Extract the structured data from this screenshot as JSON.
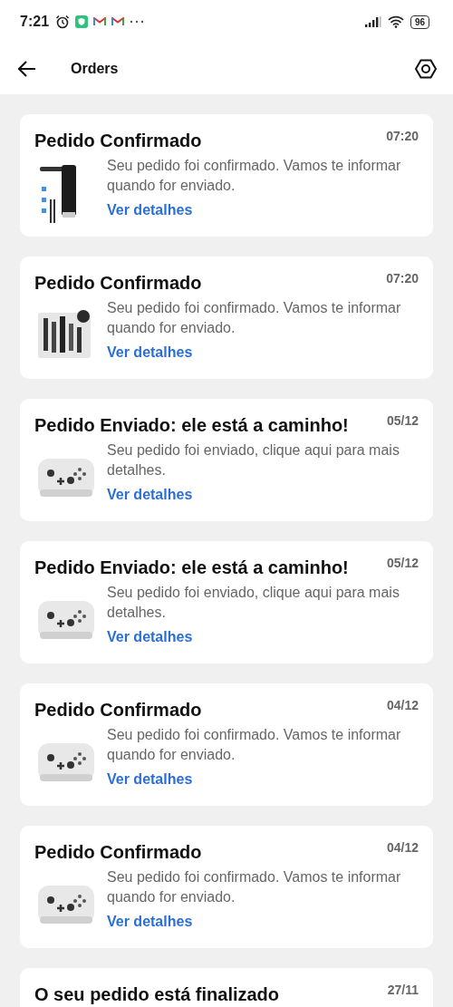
{
  "status_bar": {
    "time": "7:21",
    "battery": "96"
  },
  "header": {
    "title": "Orders"
  },
  "orders": [
    {
      "title": "Pedido Confirmado",
      "time": "07:20",
      "message": "Seu pedido foi confirmado. Vamos te informar quando for enviado.",
      "link": "Ver detalhes"
    },
    {
      "title": "Pedido Confirmado",
      "time": "07:20",
      "message": "Seu pedido foi confirmado. Vamos te informar quando for enviado.",
      "link": "Ver detalhes"
    },
    {
      "title": "Pedido Enviado: ele está a caminho!",
      "time": "05/12",
      "message": "Seu pedido foi enviado, clique aqui para mais detalhes.",
      "link": "Ver detalhes"
    },
    {
      "title": "Pedido Enviado: ele está a caminho!",
      "time": "05/12",
      "message": "Seu pedido foi enviado, clique aqui para mais detalhes.",
      "link": "Ver detalhes"
    },
    {
      "title": "Pedido Confirmado",
      "time": "04/12",
      "message": "Seu pedido foi confirmado. Vamos te informar quando for enviado.",
      "link": "Ver detalhes"
    },
    {
      "title": "Pedido Confirmado",
      "time": "04/12",
      "message": "Seu pedido foi confirmado. Vamos te informar quando for enviado.",
      "link": "Ver detalhes"
    },
    {
      "title": "O seu pedido está finalizado",
      "time": "27/11"
    }
  ]
}
